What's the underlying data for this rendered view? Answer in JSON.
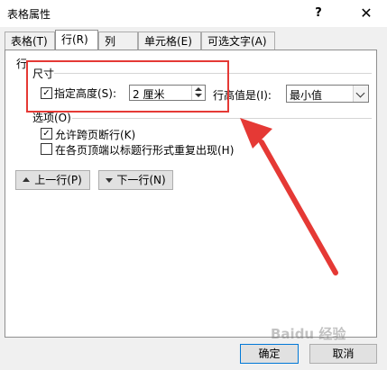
{
  "window": {
    "title": "表格属性",
    "help_glyph": "?",
    "close_glyph": "✕"
  },
  "tabs": [
    {
      "label": "表格(T)"
    },
    {
      "label": "行(R)"
    },
    {
      "label": "列(U)"
    },
    {
      "label": "单元格(E)"
    },
    {
      "label": "可选文字(A)"
    }
  ],
  "active_tab": "行(R)",
  "panel": {
    "section_label": "行",
    "size_group": {
      "label": "尺寸",
      "specify_height": {
        "label": "指定高度(S):",
        "checked": true
      },
      "height_value": "2 厘米",
      "row_height_is_label": "行高值是(I):",
      "row_height_is_value": "最小值"
    },
    "options_group": {
      "label": "选项(O)",
      "allow_break": {
        "label": "允许跨页断行(K)",
        "checked": true
      },
      "repeat_header": {
        "label": "在各页顶端以标题行形式重复出现(H)",
        "checked": false
      }
    },
    "prev_row_label": "上一行(P)",
    "next_row_label": "下一行(N)"
  },
  "footer": {
    "ok_label": "确定",
    "cancel_label": "取消"
  },
  "watermark_text": "Baidu 经验",
  "annotation_color": "#e53935"
}
